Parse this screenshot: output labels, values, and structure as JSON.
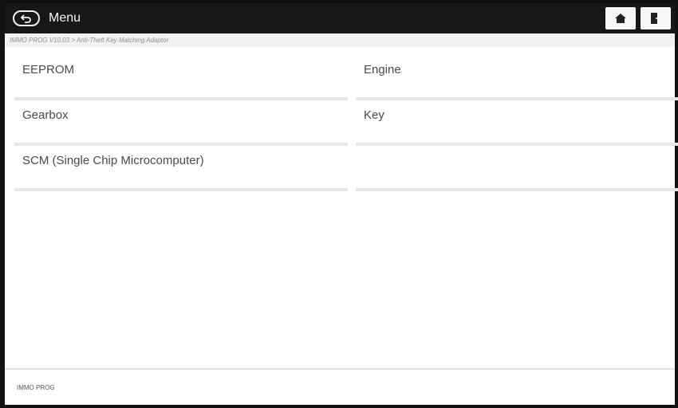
{
  "header": {
    "title": "Menu"
  },
  "breadcrumb": "IMMO PROG V10.03 > Anti-Theft Key Matching Adaptor",
  "menu": {
    "items": [
      {
        "label": "EEPROM"
      },
      {
        "label": "Engine"
      },
      {
        "label": "Gearbox"
      },
      {
        "label": "Key"
      },
      {
        "label": "SCM (Single Chip Microcomputer)"
      },
      {
        "label": ""
      }
    ]
  },
  "footer": {
    "label": "IMMO PROG"
  },
  "icons": {
    "back": "back-arrow-icon",
    "home": "home-icon",
    "exit": "exit-icon"
  }
}
